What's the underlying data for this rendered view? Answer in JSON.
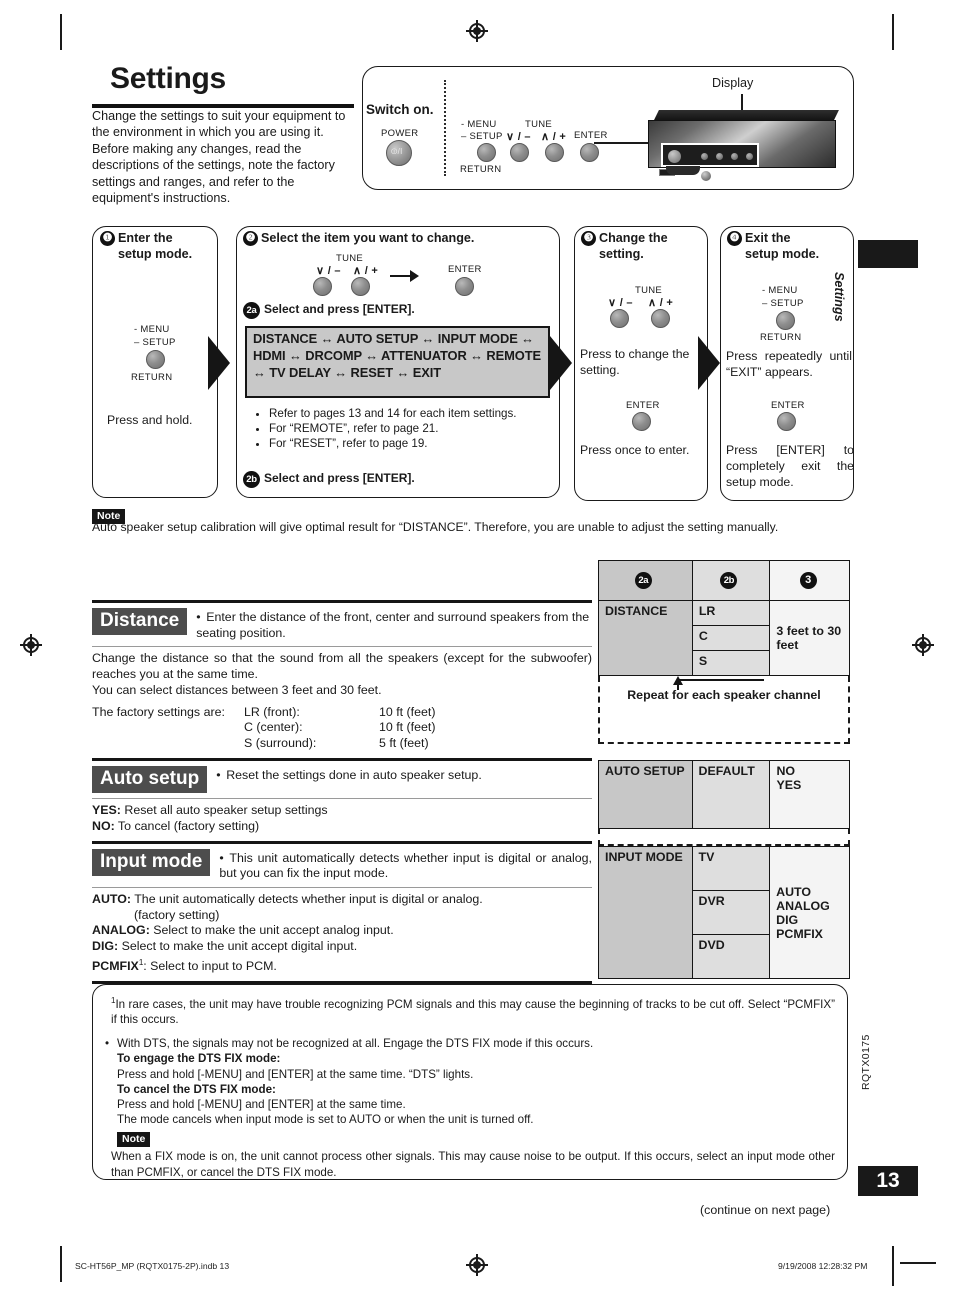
{
  "page": {
    "title": "Settings",
    "intro": "Change the settings to suit your equipment to the environment in which you are using it. Before making any changes, read the descriptions of the settings, note the factory settings and ranges, and refer to the equipment's instructions.",
    "side_tab_label": "Settings",
    "doc_code": "RQTX0175",
    "page_number": "13",
    "continue_note": "(continue on next page)",
    "footer_left": "SC-HT56P_MP (RQTX0175-2P).indb   13",
    "footer_right": "9/19/2008   12:28:32 PM"
  },
  "switch_panel": {
    "switch_on_label": "Switch on.",
    "display_label": "Display",
    "power_label": "POWER",
    "power_glyph": "⏼/I",
    "menu_label": "- MENU",
    "setup_label": "– SETUP",
    "return_label": "RETURN",
    "tune_label": "TUNE",
    "tune_down_label": "∨ / –",
    "tune_up_label": "∧ / +",
    "enter_label": "ENTER"
  },
  "steps": [
    {
      "num": "❶",
      "heading_line1": "Enter the",
      "heading_line2": "setup mode.",
      "menu_label": "- MENU",
      "setup_label": "– SETUP",
      "return_label": "RETURN",
      "instruction": "Press and hold."
    },
    {
      "num": "❷",
      "heading": "Select the item you want to change.",
      "tune_label": "TUNE",
      "tune_down_label": "∨ / –",
      "tune_up_label": "∧ / +",
      "enter_label": "ENTER",
      "sub_a_num": "2a",
      "sub_a_text": "Select and press [ENTER].",
      "item_list": "DISTANCE ↔ AUTO SETUP ↔ INPUT MODE ↔ HDMI ↔ DRCOMP ↔ ATTENUATOR ↔ REMOTE ↔ TV DELAY ↔ RESET ↔ EXIT",
      "bullets": [
        "Refer to pages 13 and 14 for each item settings.",
        "For “REMOTE”, refer to page 21.",
        "For “RESET”, refer to page 19."
      ],
      "sub_b_num": "2b",
      "sub_b_text": "Select and press [ENTER]."
    },
    {
      "num": "❸",
      "heading_line1": "Change the",
      "heading_line2": "setting.",
      "tune_label": "TUNE",
      "tune_down_label": "∨ / –",
      "tune_up_label": "∧ / +",
      "instruction1": "Press to change the setting.",
      "enter_label": "ENTER",
      "instruction2": "Press once to enter."
    },
    {
      "num": "❹",
      "heading_line1": "Exit the",
      "heading_line2": "setup mode.",
      "menu_label": "- MENU",
      "setup_label": "– SETUP",
      "return_label": "RETURN",
      "instruction1": "Press repeatedly until “EXIT” appears.",
      "enter_label": "ENTER",
      "instruction2": "Press [ENTER] to completely exit the setup mode."
    }
  ],
  "note_top": {
    "tag": "Note",
    "text": "Auto speaker setup calibration will give optimal result for “DISTANCE”. Therefore, you are unable to adjust the setting manually."
  },
  "sections": [
    {
      "tag": "Distance",
      "desc": "Enter the distance of the front, center and surround speakers from the seating position.",
      "body1": "Change the distance so that the sound from all the speakers (except for the subwoofer) reaches you at the same time.",
      "body2": "You can select distances between 3 feet and 30 feet.",
      "factory_label": "The factory settings are:",
      "factory_rows": [
        {
          "name": "LR (front):",
          "value": "10 ft (feet)"
        },
        {
          "name": "C (center):",
          "value": "10 ft (feet)"
        },
        {
          "name": "S (surround):",
          "value": "5 ft (feet)"
        }
      ]
    },
    {
      "tag": "Auto setup",
      "desc": "Reset the settings done in auto speaker setup.",
      "options": [
        {
          "key": "YES:",
          "text": " Reset all auto speaker setup settings"
        },
        {
          "key": "NO:",
          "text": " To cancel (factory setting)"
        }
      ]
    },
    {
      "tag": "Input mode",
      "desc": "This unit automatically detects whether input is digital or analog, but you can fix the input mode.",
      "options": [
        {
          "key": "AUTO:",
          "text": " The unit automatically detects whether input is digital or analog."
        },
        {
          "key": "",
          "text": "(factory setting)"
        },
        {
          "key": "ANALOG:",
          "text": " Select to make the unit accept analog input."
        },
        {
          "key": "DIG:",
          "text": " Select to make the unit accept digital input."
        },
        {
          "key": "PCMFIX",
          "sup": "1",
          "text": ": Select to input to PCM."
        }
      ]
    }
  ],
  "value_table": {
    "headers": [
      "2a",
      "2b",
      "3"
    ],
    "distance": {
      "item": "DISTANCE",
      "channels": [
        "LR",
        "C",
        "S"
      ],
      "range": "3 feet to 30 feet",
      "repeat_note": "Repeat for each speaker channel"
    },
    "auto_setup": {
      "item": "AUTO SETUP",
      "param": "DEFAULT",
      "values": [
        "NO",
        "YES"
      ]
    },
    "input_mode": {
      "item": "INPUT MODE",
      "inputs": [
        "TV",
        "DVR",
        "DVD"
      ],
      "values": [
        "AUTO",
        "ANALOG",
        "DIG",
        "PCMFIX"
      ]
    }
  },
  "footnote": {
    "sup": "1",
    "line1": "In rare cases, the unit may have trouble recognizing PCM signals and this may cause the beginning of tracks to be cut off. Select “PCMFIX” if this occurs.",
    "bullet1": "With DTS, the signals may not be recognized at all. Engage the DTS FIX mode if this occurs.",
    "engage_heading": "To engage the DTS FIX mode:",
    "engage_text": "Press and hold [-MENU] and [ENTER] at the same time. “DTS” lights.",
    "cancel_heading": "To cancel the DTS FIX mode:",
    "cancel_text": "Press and hold [-MENU] and [ENTER] at the same time.",
    "cancel_text2": "The mode cancels when input mode is set to AUTO or when the unit is turned off.",
    "note_tag": "Note",
    "note_text": "When a FIX mode is on, the unit cannot process other signals. This may cause noise to be output. If this occurs, select an input mode other than PCMFIX, or cancel the DTS FIX mode."
  }
}
